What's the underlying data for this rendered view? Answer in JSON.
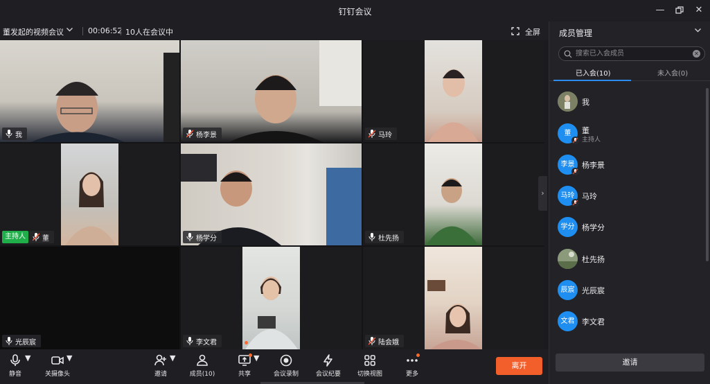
{
  "window": {
    "title": "钉钉会议"
  },
  "infobar": {
    "meeting_name": "董发起的视频会议",
    "timer": "00:06:52",
    "participant_count": "10人在会议中",
    "fullscreen_label": "全屏"
  },
  "tiles": [
    {
      "name": "我",
      "host": false
    },
    {
      "name": "杨李景",
      "host": false
    },
    {
      "name": "马玲",
      "host": false
    },
    {
      "name": "董",
      "host": true,
      "host_label": "主持人"
    },
    {
      "name": "杨学分",
      "host": false
    },
    {
      "name": "杜先扬",
      "host": false
    },
    {
      "name": "光辰宸",
      "host": false
    },
    {
      "name": "李文君",
      "host": false
    },
    {
      "name": "陆会娥",
      "host": false
    }
  ],
  "sidebar": {
    "title": "成员管理",
    "search_placeholder": "搜索已入会成员",
    "tab_joined": "已入会(10)",
    "tab_not_joined": "未入会(0)",
    "members": [
      {
        "name": "我",
        "avatar": "",
        "role": ""
      },
      {
        "name": "董",
        "avatar": "董",
        "role": "主持人"
      },
      {
        "name": "杨李景",
        "avatar": "李景",
        "role": ""
      },
      {
        "name": "马玲",
        "avatar": "马玲",
        "role": ""
      },
      {
        "name": "杨学分",
        "avatar": "学分",
        "role": ""
      },
      {
        "name": "杜先扬",
        "avatar": "",
        "role": ""
      },
      {
        "name": "光辰宸",
        "avatar": "辰宸",
        "role": ""
      },
      {
        "name": "李文君",
        "avatar": "文君",
        "role": ""
      }
    ],
    "invite_label": "邀请"
  },
  "toolbar": {
    "mute": "静音",
    "camera_off": "关摄像头",
    "invite": "邀请",
    "members": "成员(10)",
    "share": "共享",
    "record": "会议录制",
    "minutes": "会议纪要",
    "switch_view": "切换视图",
    "more": "更多",
    "leave": "离开"
  },
  "colors": {
    "accent": "#2d8cf0",
    "leave": "#f25f2a",
    "host": "#1fae4a"
  }
}
